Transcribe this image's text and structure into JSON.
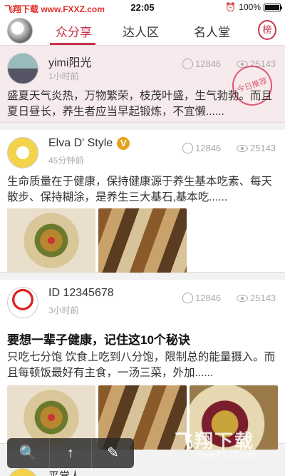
{
  "status_bar": {
    "watermark": "飞翔下载 www.FXXZ.com",
    "time": "22:05",
    "battery": "100%"
  },
  "nav": {
    "tabs": [
      "众分享",
      "达人区",
      "名人堂"
    ],
    "active_tab": "众分享",
    "rank_label": "榜",
    "accent_color": "#c8334d"
  },
  "feed": [
    {
      "user": "yimi阳光",
      "time": "1小时前",
      "likes": "12846",
      "views": "25143",
      "stamp": "今日推荐",
      "text": "盛夏天气炎热，万物繁荣，枝茂叶盛，生气勃勃。而且夏日昼长，养生者应当早起锻炼，不宜懒......"
    },
    {
      "user": "Elva D' Style",
      "verified_badge": "V",
      "time": "45分钟前",
      "likes": "12846",
      "views": "25143",
      "text": "生命质量在于健康，保持健康源于养生基本吃素、每天散步、保持糊涂，是养生三大基石,基本吃......"
    },
    {
      "user": "ID 12345678",
      "time": "3小时前",
      "likes": "12846",
      "views": "25143",
      "title": "要想一辈子健康，记住这10个秘诀",
      "text": "只吃七分饱 饮食上吃到八分饱，限制总的能量摄入。而且每顿饭最好有主食，一汤三菜，外加......"
    },
    {
      "user": "平常人"
    }
  ],
  "toolbar": {
    "search_icon": "🔍",
    "top_icon": "↑",
    "edit_icon": "✎"
  },
  "watermark_bottom": {
    "brand": "飞翔下载",
    "url": "www.FXXZ.com"
  }
}
